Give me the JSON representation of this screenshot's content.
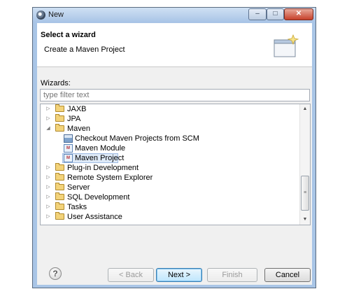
{
  "window": {
    "title": "New",
    "controls": {
      "minimize": "‒",
      "maximize": "□",
      "close": "✕"
    }
  },
  "banner": {
    "title": "Select a wizard",
    "description": "Create a Maven Project",
    "icon": "wizard-banner-icon"
  },
  "wizards_label": "Wizards:",
  "filter": {
    "placeholder": "type filter text",
    "value": ""
  },
  "tree": {
    "items": [
      {
        "label": "JAXB",
        "icon": "folder-icon",
        "expanded": false
      },
      {
        "label": "JPA",
        "icon": "folder-icon",
        "expanded": false
      },
      {
        "label": "Maven",
        "icon": "folder-icon",
        "expanded": true
      },
      {
        "label": "Checkout Maven Projects from SCM",
        "icon": "checkout-icon"
      },
      {
        "label": "Maven Module",
        "icon": "maven-icon"
      },
      {
        "label": "Maven Project",
        "icon": "maven-icon",
        "selected": true
      },
      {
        "label": "Plug-in Development",
        "icon": "folder-icon",
        "expanded": false
      },
      {
        "label": "Remote System Explorer",
        "icon": "folder-icon",
        "expanded": false
      },
      {
        "label": "Server",
        "icon": "folder-icon",
        "expanded": false
      },
      {
        "label": "SQL Development",
        "icon": "folder-icon",
        "expanded": false
      },
      {
        "label": "Tasks",
        "icon": "folder-icon",
        "expanded": false
      },
      {
        "label": "User Assistance",
        "icon": "folder-icon",
        "expanded": false
      }
    ],
    "collapsed_glyph": "▷",
    "expanded_glyph": "◢"
  },
  "scrollbar": {
    "up": "▲",
    "down": "▼",
    "grip": "≡"
  },
  "buttons": {
    "help": "?",
    "back": "< Back",
    "next": "Next >",
    "finish": "Finish",
    "cancel": "Cancel"
  },
  "colors": {
    "window_frame": "#a9c5e6",
    "selection": "#dde9f7",
    "folder": "#f3d37a",
    "default_button": "#bee6fd"
  }
}
